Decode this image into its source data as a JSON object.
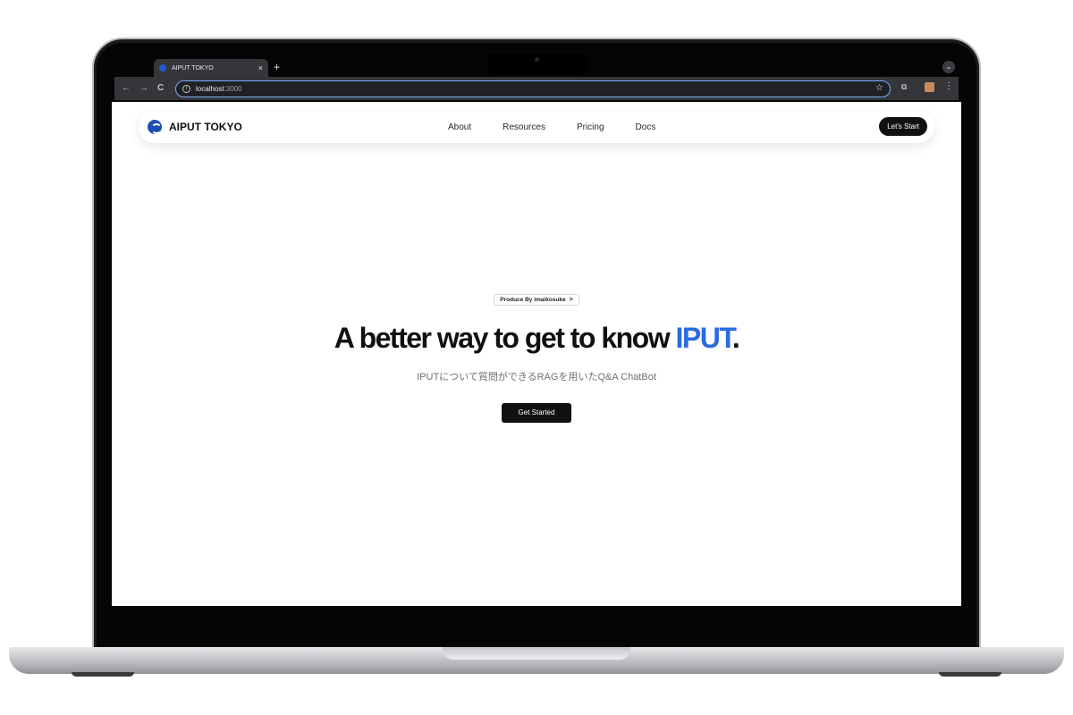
{
  "browser": {
    "tab_title": "AIPUT TOKYO",
    "tab_close": "×",
    "new_tab": "+",
    "tab_menu": "⌄",
    "back": "←",
    "forward": "→",
    "reload": "C",
    "url_host": "localhost",
    "url_port": ":3000",
    "star": "☆",
    "extensions": "⧉",
    "menu": "⋮"
  },
  "navbar": {
    "brand": "AIPUT TOKYO",
    "links": [
      "About",
      "Resources",
      "Pricing",
      "Docs"
    ],
    "cta": "Let's Start"
  },
  "hero": {
    "badge": "Produce By imaikosuke",
    "badge_arrow": ">",
    "headline_main": "A better way to get to know ",
    "headline_accent": "IPUT",
    "headline_end": ".",
    "subtitle": "IPUTについて質問ができるRAGを用いたQ&A ChatBot",
    "cta": "Get Started"
  },
  "colors": {
    "accent": "#2a6be0",
    "button_dark": "#111111",
    "browser_chrome": "#35363a"
  }
}
